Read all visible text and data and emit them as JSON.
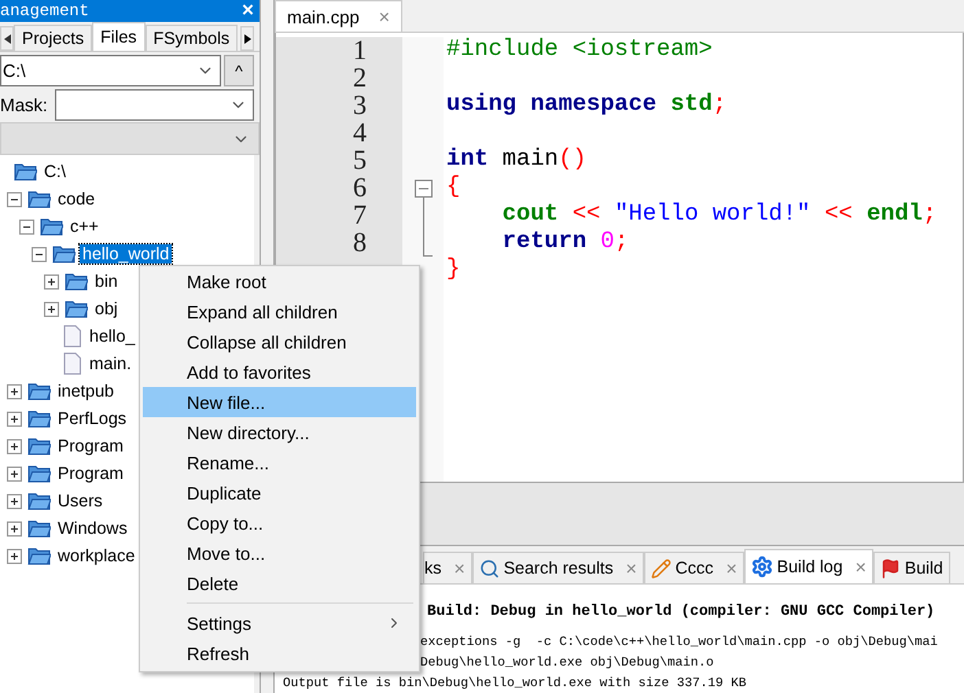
{
  "left_panel": {
    "title": "anagement",
    "close": "×",
    "tabs": [
      {
        "label": "Projects",
        "selected": false
      },
      {
        "label": "Files",
        "selected": true
      },
      {
        "label": "FSymbols",
        "selected": false
      }
    ],
    "path": {
      "value": "C:\\",
      "up": "^"
    },
    "mask": {
      "label": "Mask:"
    },
    "tree": [
      {
        "label": "C:\\",
        "kind": "root",
        "selected": false,
        "children": [
          {
            "label": "code",
            "kind": "folder",
            "expanded": true,
            "selected": false,
            "children": [
              {
                "label": "c++",
                "kind": "folder",
                "expanded": true,
                "selected": false,
                "children": [
                  {
                    "label": "hello_world",
                    "kind": "folder",
                    "expanded": true,
                    "selected": true,
                    "children": [
                      {
                        "label": "bin",
                        "kind": "folder",
                        "expanded": false,
                        "selected": false
                      },
                      {
                        "label": "obj",
                        "kind": "folder",
                        "expanded": false,
                        "selected": false
                      },
                      {
                        "label": "hello_",
                        "kind": "file",
                        "selected": false
                      },
                      {
                        "label": "main.",
                        "kind": "file",
                        "selected": false
                      }
                    ]
                  }
                ]
              }
            ]
          },
          {
            "label": "inetpub",
            "kind": "folder",
            "expanded": false,
            "selected": false
          },
          {
            "label": "PerfLogs",
            "kind": "folder",
            "expanded": false,
            "selected": false
          },
          {
            "label": "Program",
            "kind": "folder",
            "expanded": false,
            "selected": false
          },
          {
            "label": "Program",
            "kind": "folder",
            "expanded": false,
            "selected": false
          },
          {
            "label": "Users",
            "kind": "folder",
            "expanded": false,
            "selected": false
          },
          {
            "label": "Windows",
            "kind": "folder",
            "expanded": false,
            "selected": false
          },
          {
            "label": "workplace",
            "kind": "folder",
            "expanded": false,
            "selected": false
          }
        ]
      }
    ]
  },
  "editor": {
    "tab": {
      "label": "main.cpp",
      "close": "×"
    },
    "lines": [
      {
        "number": "1",
        "fold_start": false,
        "tokens": [
          {
            "text": "#include <iostream>",
            "kind": "preproc"
          }
        ]
      },
      {
        "number": "2",
        "fold_start": false
      },
      {
        "number": "3",
        "fold_start": false,
        "tokens": [
          {
            "text": "using namespace",
            "kind": "keyword"
          },
          {
            "text": " std",
            "kind": "ident"
          },
          {
            "text": ";",
            "kind": "punct"
          }
        ]
      },
      {
        "number": "4",
        "fold_start": false
      },
      {
        "number": "5",
        "fold_start": false,
        "tokens": [
          {
            "text": "int",
            "kind": "keyword"
          },
          {
            "text": " main",
            "kind": "plain"
          },
          {
            "text": "()",
            "kind": "punct"
          }
        ]
      },
      {
        "number": "6",
        "fold_start": true,
        "tokens": [
          {
            "text": "{",
            "kind": "punct"
          }
        ]
      },
      {
        "number": "7",
        "fold_start": false,
        "tokens": [
          {
            "text": "    cout",
            "kind": "ident"
          },
          {
            "text": " << ",
            "kind": "punct"
          },
          {
            "text": "\"Hello world!\"",
            "kind": "string"
          },
          {
            "text": " << ",
            "kind": "punct"
          },
          {
            "text": "endl",
            "kind": "ident"
          },
          {
            "text": ";",
            "kind": "punct"
          }
        ]
      },
      {
        "number": "8",
        "fold_start": false,
        "tokens": [
          {
            "text": "    return",
            "kind": "keyword"
          },
          {
            "text": " 0",
            "kind": "number"
          },
          {
            "text": ";",
            "kind": "punct"
          }
        ]
      },
      {
        "fold_start": false,
        "tokens": [
          {
            "text": "}",
            "kind": "punct"
          }
        ]
      }
    ]
  },
  "bottom_panel": {
    "tabs": [
      {
        "label": "ks",
        "kind": "plain",
        "selected": false
      },
      {
        "label": "Search results",
        "kind": "search",
        "selected": false
      },
      {
        "label": "Cccc",
        "kind": "pencil",
        "selected": false
      },
      {
        "label": "Build log",
        "kind": "gear",
        "selected": true
      },
      {
        "label": "Build",
        "kind": "flag",
        "selected": false
      }
    ],
    "close": "×",
    "log": [
      {
        "text": "Build: Debug in hello_world (compiler: GNU GCC Compiler)",
        "kind": "header"
      },
      {
        "text": "exceptions -g  -c C:\\code\\c++\\hello_world\\main.cpp -o obj\\Debug\\mai",
        "kind": "cut"
      },
      {
        "text": "Debug\\hello_world.exe obj\\Debug\\main.o",
        "kind": "cut"
      },
      {
        "text": "Output file is bin\\Debug\\hello_world.exe with size 337.19 KB",
        "kind": "plain"
      }
    ]
  },
  "context_menu": {
    "items": [
      {
        "label": "Make root",
        "selected": false
      },
      {
        "label": "Expand all children",
        "selected": false
      },
      {
        "label": "Collapse all children",
        "selected": false
      },
      {
        "label": "Add to favorites",
        "selected": false
      },
      {
        "label": "New file...",
        "selected": true
      },
      {
        "label": "New directory...",
        "selected": false
      },
      {
        "label": "Rename...",
        "selected": false
      },
      {
        "label": "Duplicate",
        "selected": false
      },
      {
        "label": "Copy to...",
        "selected": false
      },
      {
        "label": "Move to...",
        "selected": false
      },
      {
        "label": "Delete",
        "selected": false
      }
    ],
    "bottom_items": [
      {
        "label": "Settings",
        "submenu": true,
        "selected": false
      },
      {
        "label": "Refresh",
        "submenu": false,
        "selected": false
      }
    ]
  }
}
